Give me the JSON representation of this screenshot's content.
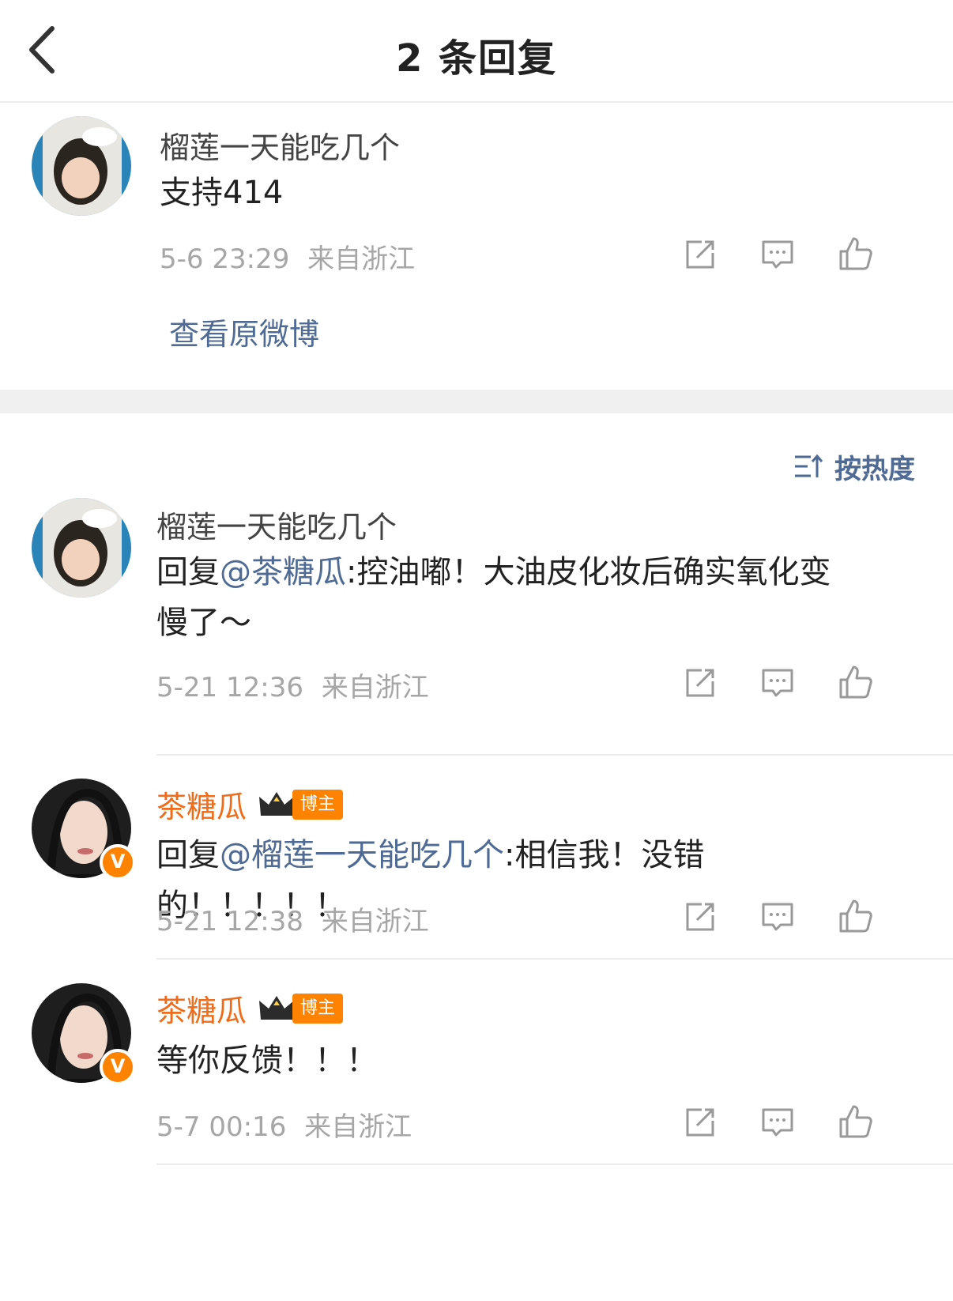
{
  "header": {
    "title": "2 条回复"
  },
  "main_comment": {
    "user": "榴莲一天能吃几个",
    "text": "支持414",
    "time": "5-6 23:29",
    "location": "来自浙江",
    "view_original": "查看原微博"
  },
  "sort": {
    "label": "按热度"
  },
  "replies": [
    {
      "user": "榴莲一天能吃几个",
      "prefix": "回复",
      "mention": "@茶糖瓜",
      "text_line1": ":控油嘟！大油皮化妆后确实氧化变",
      "text_line2": "慢了～",
      "time": "5-21 12:36",
      "location": "来自浙江"
    },
    {
      "user": "茶糖瓜",
      "badge": "博主",
      "prefix": "回复",
      "mention": "@榴莲一天能吃几个",
      "text": ":相信我！没错的！！！！！",
      "time": "5-21 12:38",
      "location": "来自浙江"
    },
    {
      "user": "茶糖瓜",
      "badge": "博主",
      "text": "等你反馈！！！",
      "time": "5-7 00:16",
      "location": "来自浙江"
    }
  ],
  "icons": {
    "back": "chevron-left-icon",
    "repost": "repost-icon",
    "comment": "comment-icon",
    "like": "thumbs-up-icon",
    "sort": "sort-icon",
    "verified": "verified-v-icon",
    "crown": "crown-icon"
  },
  "colors": {
    "link": "#4e6a95",
    "username_vip": "#ef6c1a",
    "meta": "#a6a6a6",
    "badge": "#ff8200"
  }
}
